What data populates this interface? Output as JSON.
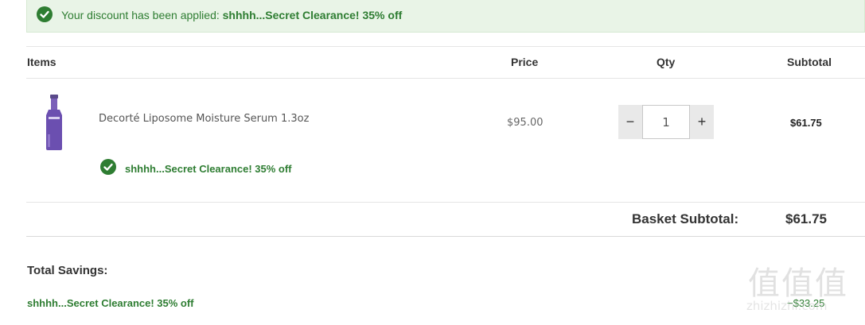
{
  "banner": {
    "message": "Your discount has been applied: ",
    "code": "shhhh...Secret Clearance! 35% off",
    "icon": "check-circle-icon"
  },
  "table": {
    "headers": {
      "items": "Items",
      "price": "Price",
      "qty": "Qty",
      "subtotal": "Subtotal"
    },
    "rows": [
      {
        "name": "Decorté Liposome Moisture Serum 1.3oz",
        "price": "$95.00",
        "qty": "1",
        "subtotal": "$61.75",
        "promo": "shhhh...Secret Clearance! 35% off",
        "minus": "−",
        "plus": "+"
      }
    ]
  },
  "basket": {
    "label": "Basket Subtotal:",
    "value": "$61.75"
  },
  "savings": {
    "label": "Total Savings:",
    "name": "shhhh...Secret Clearance! 35% off",
    "amount": "−$33.25"
  },
  "watermark": {
    "chars": "值值值",
    "url": "zhizhizhi.com"
  },
  "colors": {
    "accent_green": "#2e7d32",
    "banner_bg": "#e9f4e7",
    "stepper_bg": "#e9e9e9"
  }
}
